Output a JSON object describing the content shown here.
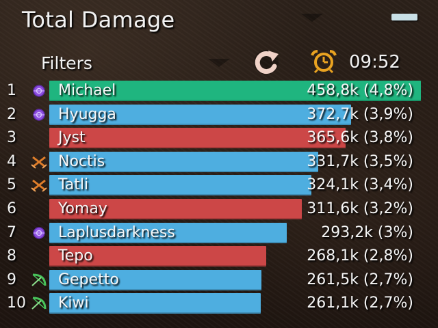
{
  "meter": {
    "title": "Total Damage",
    "filters_label": "Filters",
    "clock": "09:52",
    "icons": {
      "minimize": "minimize-icon",
      "reset": "reset-icon",
      "clock": "alarm-clock-icon"
    },
    "colors": {
      "leader": "#1fb57f",
      "blue": "#4eaee0",
      "red": "#cc4747",
      "icon_purple": "#8d4ee0",
      "icon_orange": "#e07e2a",
      "icon_green": "#48c25a",
      "clock_icon": "#e9a321"
    }
  },
  "rows": [
    {
      "rank": "1",
      "name": "Michael",
      "damage": "458,8k (4,8%)",
      "fill": 1.0,
      "color": "#1fb57f",
      "icon": "purple-orb-icon"
    },
    {
      "rank": "2",
      "name": "Hyugga",
      "damage": "372,7k (3,9%)",
      "fill": 0.812,
      "color": "#4eaee0",
      "icon": "purple-orb-icon"
    },
    {
      "rank": "3",
      "name": "Jyst",
      "damage": "365,6k (3,8%)",
      "fill": 0.797,
      "color": "#cc4747",
      "icon": ""
    },
    {
      "rank": "4",
      "name": "Noctis",
      "damage": "331,7k (3,5%)",
      "fill": 0.723,
      "color": "#4eaee0",
      "icon": "orange-crossed-swords-icon"
    },
    {
      "rank": "5",
      "name": "Tatli",
      "damage": "324,1k (3,4%)",
      "fill": 0.706,
      "color": "#4eaee0",
      "icon": "orange-crossed-swords-icon"
    },
    {
      "rank": "6",
      "name": "Yomay",
      "damage": "311,6k (3,2%)",
      "fill": 0.679,
      "color": "#cc4747",
      "icon": ""
    },
    {
      "rank": "7",
      "name": "Laplusdarkness",
      "damage": "293,2k (3%)",
      "fill": 0.639,
      "color": "#4eaee0",
      "icon": "purple-orb-icon"
    },
    {
      "rank": "8",
      "name": "Tepo",
      "damage": "268,1k (2,8%)",
      "fill": 0.584,
      "color": "#cc4747",
      "icon": ""
    },
    {
      "rank": "9",
      "name": "Gepetto",
      "damage": "261,5k (2,7%)",
      "fill": 0.57,
      "color": "#4eaee0",
      "icon": "green-bow-icon"
    },
    {
      "rank": "10",
      "name": "Kiwi",
      "damage": "261,1k (2,7%)",
      "fill": 0.569,
      "color": "#4eaee0",
      "icon": "green-bow-icon"
    }
  ]
}
